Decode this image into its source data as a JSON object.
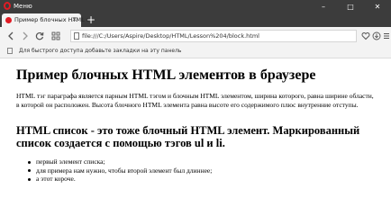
{
  "titlebar": {
    "menu_label": "Меню",
    "controls": [
      "–",
      "□",
      "✕"
    ]
  },
  "tabs": [
    {
      "title": "Пример блочных HTML э",
      "close": "×"
    }
  ],
  "new_tab_label": "+",
  "toolbar": {
    "address": "file:///C:/Users/Aspire/Desktop/HTML/Lesson%204/block.html"
  },
  "bookmarks_bar": {
    "text": "Для быстрого доступа добавьте закладки на эту панель"
  },
  "page": {
    "h1": "Пример блочных HTML элементов в браузере",
    "paragraph": "HTML тэг параграфа является парным HTML тэгом и блочным HTML элементом, ширина которого, равна ширине области, в которой он расположен. Высота блочного HTML элемента равна высоте его содержимого плюс внутренние отступы.",
    "h2": "HTML список - это тоже блочный HTML элемент. Маркированный список создается с помощью тэгов ul и li.",
    "list": [
      "первый элемент списка;",
      "для примера нам нужно, чтобы второй элемент был длиннее;",
      "а этот короче."
    ]
  },
  "icons": {
    "back": "arrow-left-icon",
    "forward": "arrow-right-icon",
    "reload": "reload-icon",
    "speed_dial": "grid-icon",
    "heart": "heart-icon",
    "download": "download-icon",
    "menu": "menu-icon"
  },
  "colors": {
    "chrome_dark": "#3c3c3c",
    "toolbar_bg": "#f3f3f3",
    "opera_red": "#e01b24"
  }
}
